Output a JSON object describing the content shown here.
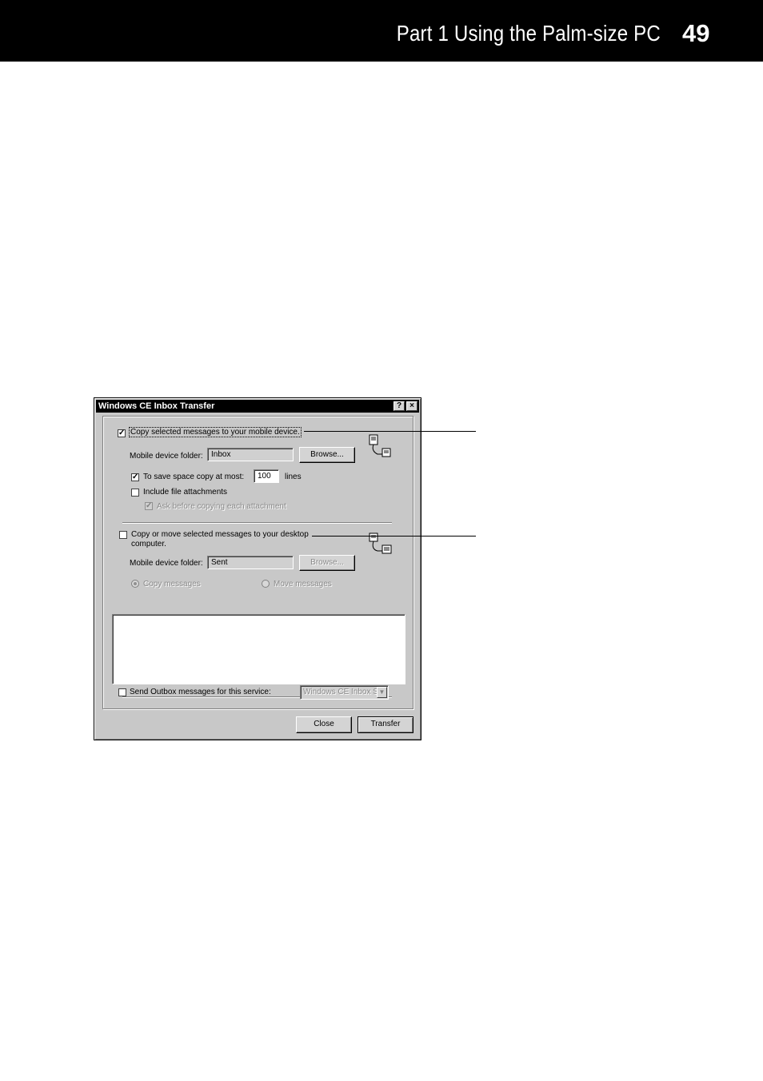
{
  "page_header": {
    "part": "Part 1  Using the Palm-size PC",
    "page_number": "49"
  },
  "dialog": {
    "title": "Windows CE Inbox Transfer",
    "help_button": "?",
    "close_glyph": "×",
    "to_device": {
      "label": "Copy selected messages to your mobile device.",
      "checked": true,
      "folder_label": "Mobile device folder:",
      "folder_value": "Inbox",
      "browse_label": "Browse...",
      "save_space_label": "To save space copy at most:",
      "save_space_checked": true,
      "lines_value": "100",
      "lines_label": "lines",
      "attachments_label": "Include file attachments",
      "attachments_checked": false,
      "ask_label": "Ask before copying each attachment",
      "ask_checked": true,
      "icon": "handheld-sync-icon"
    },
    "to_desktop": {
      "label_line1": "Copy or move selected messages to your desktop",
      "label_line2": "computer.",
      "checked": false,
      "folder_label": "Mobile device folder:",
      "folder_value": "Sent",
      "browse_label": "Browse...",
      "copy_label": "Copy messages",
      "move_label": "Move messages",
      "icon": "desktop-sync-icon"
    },
    "outbox": {
      "label": "Send Outbox messages for this service:",
      "checked": false,
      "service_value": "Windows CE Inbox S"
    },
    "buttons": {
      "close": "Close",
      "transfer": "Transfer"
    }
  },
  "colors": {
    "header_band": "#000000",
    "dialog_face": "#c8c8c8",
    "titlebar": "#000000"
  }
}
